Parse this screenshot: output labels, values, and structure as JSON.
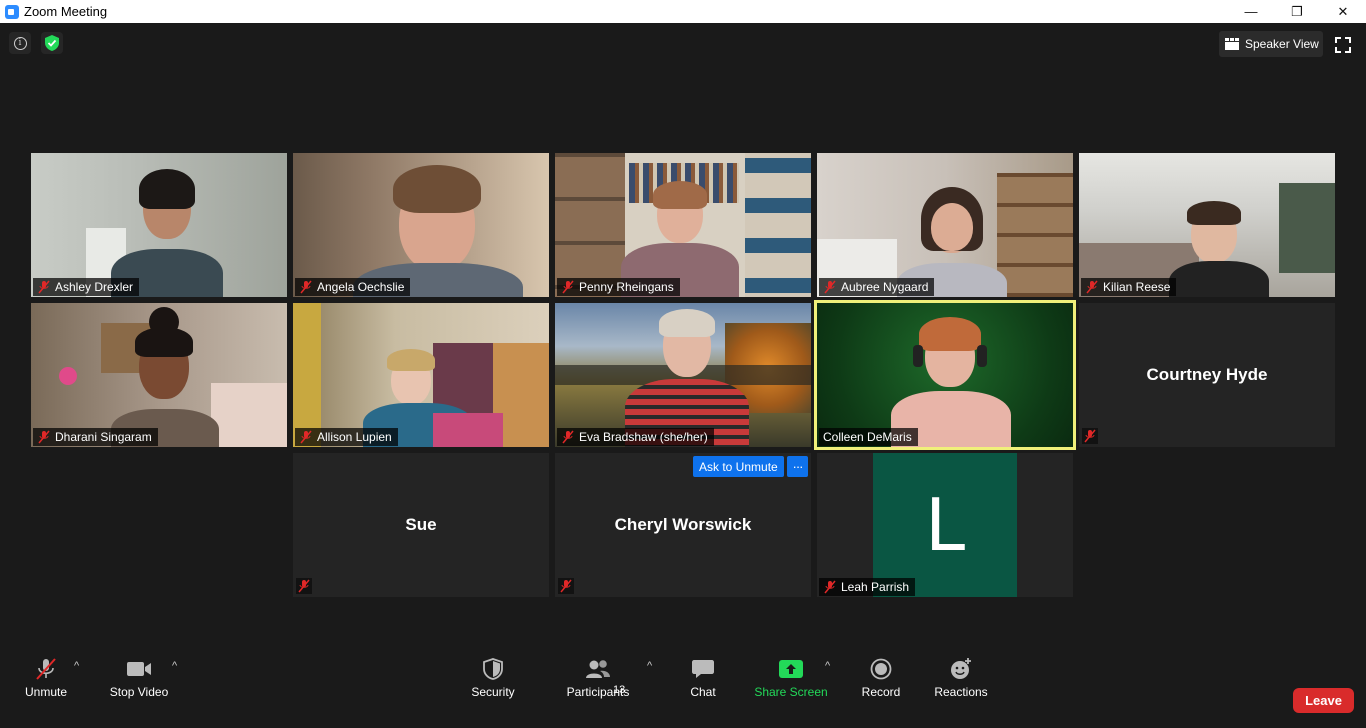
{
  "window": {
    "title": "Zoom Meeting",
    "minimize": "—",
    "restore": "❐",
    "close": "✕"
  },
  "top": {
    "speaker_view_label": "Speaker View"
  },
  "tiles": [
    {
      "name": "Ashley Drexler",
      "muted": true
    },
    {
      "name": "Angela Oechslie",
      "muted": true
    },
    {
      "name": "Penny Rheingans",
      "muted": true
    },
    {
      "name": "Aubree Nygaard",
      "muted": true
    },
    {
      "name": "Kilian Reese",
      "muted": true
    },
    {
      "name": "Dharani Singaram",
      "muted": true
    },
    {
      "name": "Allison Lupien",
      "muted": true
    },
    {
      "name": "Eva Bradshaw (she/her)",
      "muted": true
    },
    {
      "name": "Colleen DeMaris",
      "muted": false,
      "active": true
    },
    {
      "name": "Courtney Hyde",
      "muted": true
    },
    {
      "name": "Sue",
      "muted": true
    },
    {
      "name": "Cheryl Worswick",
      "muted": true
    },
    {
      "name": "Leah Parrish",
      "muted": true,
      "avatar_letter": "L"
    }
  ],
  "tile_actions": {
    "ask_to_unmute": "Ask to Unmute",
    "more": "···"
  },
  "toolbar": {
    "unmute": "Unmute",
    "stop_video": "Stop Video",
    "security": "Security",
    "participants": "Participants",
    "participants_count": "13",
    "chat": "Chat",
    "share_screen": "Share Screen",
    "record": "Record",
    "reactions": "Reactions",
    "leave": "Leave",
    "caret": "^"
  },
  "colors": {
    "share_green": "#23d959",
    "leave_red": "#d92b2b",
    "action_blue": "#0e72ed",
    "active_outline": "#f0f07a",
    "avatar_green": "#0a5643"
  }
}
